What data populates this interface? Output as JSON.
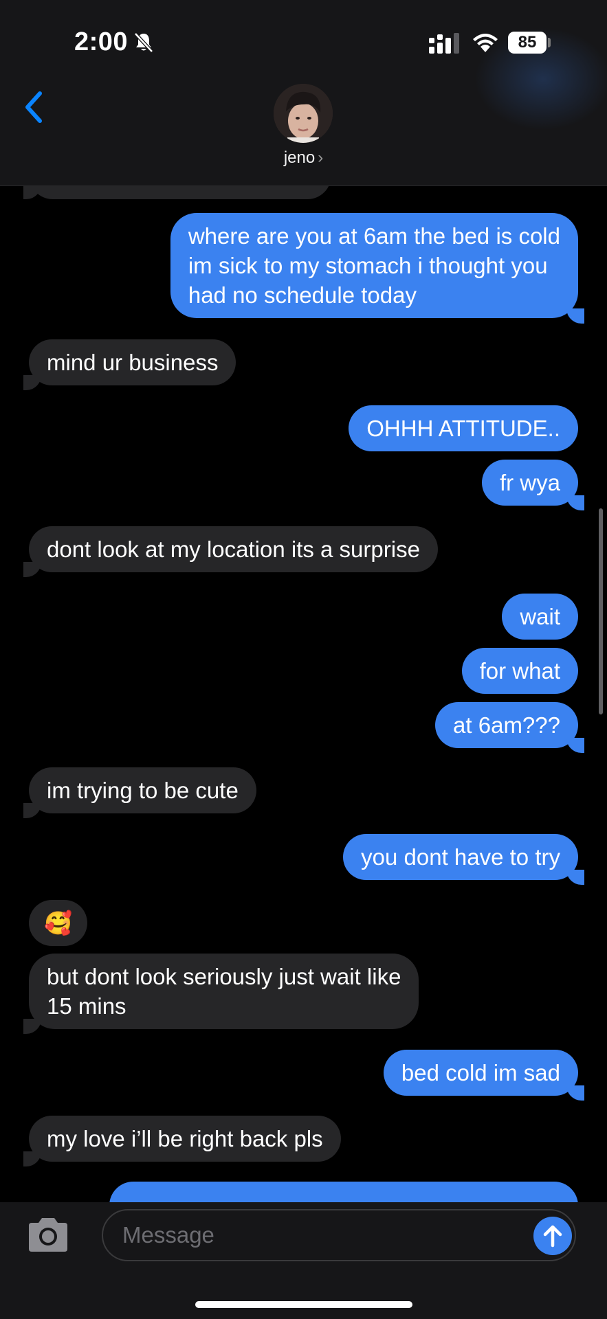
{
  "status_bar": {
    "time": "2:00",
    "battery": "85",
    "icons": [
      "bell-slash-icon",
      "signal-icon",
      "wifi-icon"
    ]
  },
  "header": {
    "back_icon": "chevron-left-icon",
    "contact_name": "jeno",
    "contact_chevron": "›"
  },
  "messages": [
    {
      "from": "me",
      "text": "where are you at 6am the bed is cold\nim sick to my stomach i thought you\nhad no schedule today"
    },
    {
      "from": "them",
      "text": "mind ur business"
    },
    {
      "from": "me",
      "text": "OHHH ATTITUDE.."
    },
    {
      "from": "me",
      "text": "fr wya"
    },
    {
      "from": "them",
      "text": "dont look at my location its a surprise"
    },
    {
      "from": "me",
      "text": "wait"
    },
    {
      "from": "me",
      "text": "for what"
    },
    {
      "from": "me",
      "text": "at 6am???"
    },
    {
      "from": "them",
      "text": "im trying to be cute"
    },
    {
      "from": "me",
      "text": "you dont have to try"
    },
    {
      "from": "them",
      "text": "🥰"
    },
    {
      "from": "them",
      "text": "but dont look seriously just wait like\n15 mins"
    },
    {
      "from": "me",
      "text": "bed cold im sad"
    },
    {
      "from": "them",
      "text": "my love i’ll be right back pls"
    }
  ],
  "composer": {
    "placeholder": "Message",
    "camera_icon": "camera-icon",
    "send_icon": "arrow-up-icon"
  },
  "colors": {
    "outgoing": "#3b82f0",
    "incoming": "#262628",
    "accent": "#0a84ff"
  }
}
